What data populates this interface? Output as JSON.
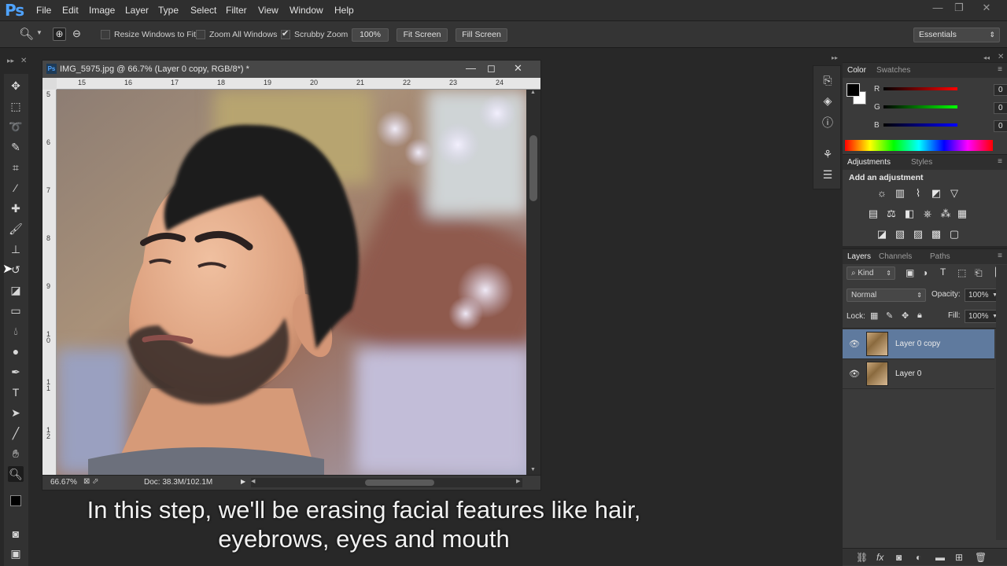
{
  "app": {
    "logo": "Ps"
  },
  "menu": [
    "File",
    "Edit",
    "Image",
    "Layer",
    "Type",
    "Select",
    "Filter",
    "View",
    "Window",
    "Help"
  ],
  "window_controls": {
    "minimize": "—",
    "restore": "❐",
    "close": "✕"
  },
  "options_bar": {
    "resize_windows": {
      "label": "Resize Windows to Fit",
      "checked": false
    },
    "zoom_all": {
      "label": "Zoom All Windows",
      "checked": false
    },
    "scrubby": {
      "label": "Scrubby Zoom",
      "checked": true
    },
    "zoom_100": "100%",
    "fit_screen": "Fit Screen",
    "fill_screen": "Fill Screen",
    "workspace": "Essentials"
  },
  "document": {
    "title": "IMG_5975.jpg @ 66.7% (Layer 0 copy, RGB/8*) *",
    "ruler_h": [
      "15",
      "16",
      "17",
      "18",
      "19",
      "20",
      "21",
      "22",
      "23",
      "24"
    ],
    "ruler_v": [
      "5",
      "6",
      "7",
      "8",
      "9",
      "1\n0",
      "1\n1",
      "1\n2"
    ],
    "zoom": "66.67%",
    "doc_size": "Doc: 38.3M/102.1M"
  },
  "color_panel": {
    "tabs": [
      "Color",
      "Swatches"
    ],
    "r": {
      "label": "R",
      "value": "0"
    },
    "g": {
      "label": "G",
      "value": "0"
    },
    "b": {
      "label": "B",
      "value": "0"
    }
  },
  "adjustments_panel": {
    "tabs": [
      "Adjustments",
      "Styles"
    ],
    "heading": "Add an adjustment"
  },
  "layers_panel": {
    "tabs": [
      "Layers",
      "Channels",
      "Paths"
    ],
    "kind": "Kind",
    "blend_mode": "Normal",
    "opacity_label": "Opacity:",
    "opacity": "100%",
    "lock_label": "Lock:",
    "fill_label": "Fill:",
    "fill": "100%",
    "layers": [
      {
        "name": "Layer 0 copy",
        "selected": true
      },
      {
        "name": "Layer 0",
        "selected": false
      }
    ]
  },
  "caption": {
    "line1": "In this step, we'll be erasing facial features like hair,",
    "line2": "eyebrows, eyes and mouth"
  },
  "colors": {
    "accent": "#4fa3ff",
    "selected_layer": "#5f7a9e",
    "panel_bg": "#3a3a3a"
  }
}
